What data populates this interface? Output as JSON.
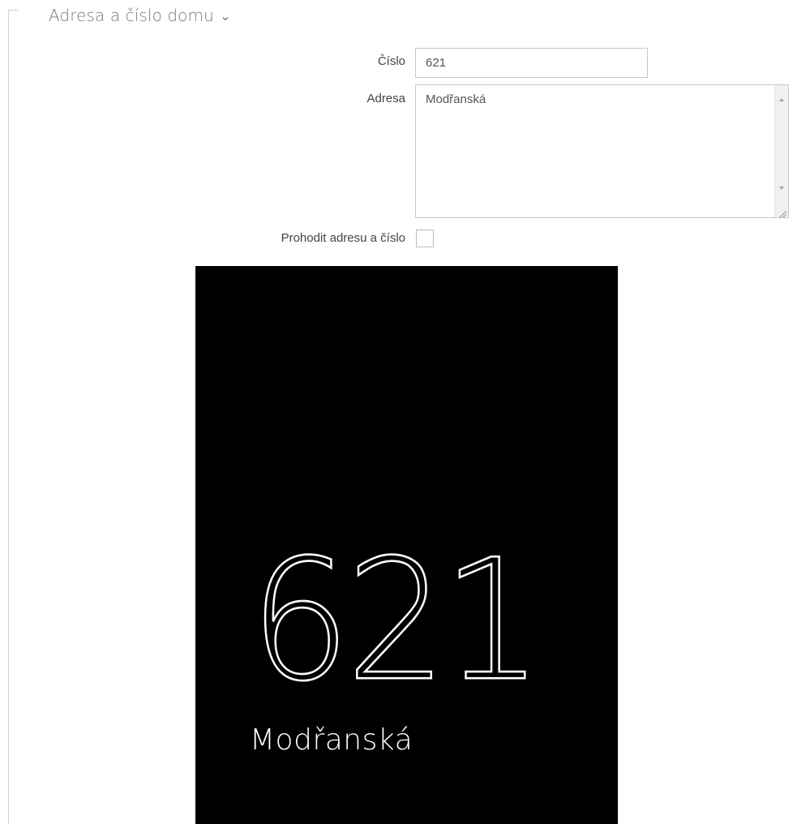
{
  "section": {
    "title": "Adresa a číslo domu",
    "chevron_icon": "chevron-down-icon"
  },
  "form": {
    "number_label": "Číslo",
    "number_value": "621",
    "address_label": "Adresa",
    "address_value": "Modřanská",
    "swap_label": "Prohodit adresu a číslo",
    "swap_checked": false
  },
  "preview": {
    "number": "621",
    "address": "Modřanská",
    "background": "#000000",
    "foreground": "#ffffff"
  },
  "colors": {
    "section_title": "#7a7a7a",
    "input_border": "#c8c8c8",
    "label_text": "#444444"
  }
}
